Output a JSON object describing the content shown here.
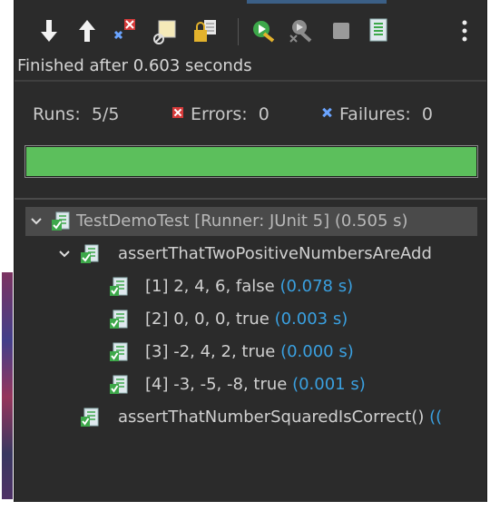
{
  "toolbar": {
    "buttons": [
      {
        "icon": "next-failure-icon"
      },
      {
        "icon": "previous-failure-icon"
      },
      {
        "icon": "show-failures-only-icon"
      },
      {
        "icon": "show-skipped-only-icon"
      },
      {
        "icon": "scroll-lock-icon"
      },
      {
        "icon": "rerun-test-icon"
      },
      {
        "icon": "rerun-failures-first-icon"
      },
      {
        "icon": "stop-icon"
      },
      {
        "icon": "test-run-history-icon"
      },
      {
        "icon": "view-menu-icon"
      }
    ]
  },
  "status": {
    "text": "Finished after 0.603 seconds"
  },
  "counters": {
    "runs_label": "Runs:",
    "runs_value": "5/5",
    "errors_label": "Errors:",
    "errors_value": "0",
    "failures_label": "Failures:",
    "failures_value": "0"
  },
  "progress": {
    "fraction": 1.0,
    "color": "#5cbf5c"
  },
  "tree": {
    "root": {
      "label": "TestDemoTest [Runner: JUnit 5] (0.505 s)"
    },
    "group": {
      "label": "assertThatTwoPositiveNumbersAreAdd"
    },
    "cases": [
      {
        "label": "[1] 2, 4, 6, false ",
        "time": "(0.078 s)"
      },
      {
        "label": "[2] 0, 0, 0, true ",
        "time": "(0.003 s)"
      },
      {
        "label": "[3] -2, 4, 2, true ",
        "time": "(0.000 s)"
      },
      {
        "label": "[4] -3, -5, -8, true ",
        "time": "(0.001 s)"
      }
    ],
    "last": {
      "label": "assertThatNumberSquaredIsCorrect() ",
      "time": "(("
    }
  },
  "colors": {
    "background": "#2b2b2b",
    "time": "#3aa0e0",
    "success": "#5cbf5c",
    "error": "#d63a3a",
    "failure": "#6aa4ff"
  }
}
